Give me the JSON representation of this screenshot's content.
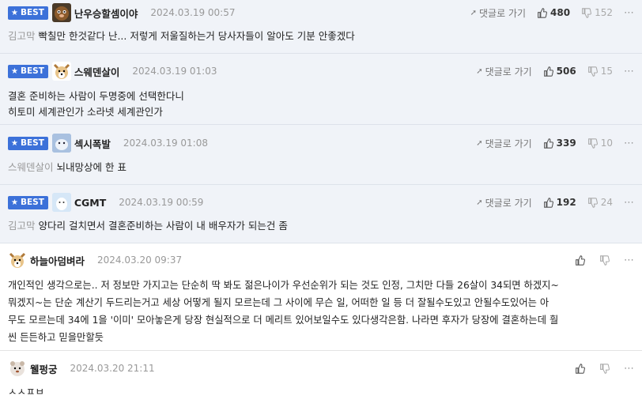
{
  "reply_label": "댓글로 가기",
  "comments": [
    {
      "best": true,
      "badge": "BEST",
      "nick": "난우승할셈이야",
      "date": "2024.03.19 00:57",
      "likes": "480",
      "dislikes": "152",
      "mention": "김고막",
      "text": "빡칠만 한것같다 난... 저렇게 저울질하는거 당사자들이 알아도 기분 안좋겠다"
    },
    {
      "best": true,
      "badge": "BEST",
      "nick": "스웨덴살이",
      "date": "2024.03.19 01:03",
      "likes": "506",
      "dislikes": "15",
      "lines": [
        "결혼 준비하는 사람이 두명중에 선택한다니",
        "히토미 세계관인가 소라넷 세계관인가"
      ]
    },
    {
      "best": true,
      "badge": "BEST",
      "nick": "섹시폭발",
      "date": "2024.03.19 01:08",
      "likes": "339",
      "dislikes": "10",
      "mention": "스웨덴살이",
      "text": "뇌내망상에 한 표"
    },
    {
      "best": true,
      "badge": "BEST",
      "nick": "CGMT",
      "date": "2024.03.19 00:59",
      "likes": "192",
      "dislikes": "24",
      "mention": "김고막",
      "text": "양다리 걸치면서 결혼준비하는 사람이 내 배우자가 되는건 좀"
    },
    {
      "best": false,
      "nick": "하늘아덤벼라",
      "date": "2024.03.20 09:37",
      "lines": [
        "개인적인 생각으로는.. 저 정보만 가지고는 단순히 딱 봐도 젊은나이가 우선순위가 되는 것도 인정, 그치만 다들 26살이 34되면 하겠지~",
        "뭐겠지~는 단순 계산기 두드리는거고 세상 어떻게 될지 모르는데 그 사이에 무슨 일, 어떠한 일 등 더 잘될수도있고 안될수도있어는 아",
        "무도 모르는데 34에 1을 '이미' 모아놓은게 당장 현실적으로 더 메리트 있어보일수도 있다생각은함. 나라면 후자가 당장에 결혼하는데 훨",
        "씬 든든하고 믿을만할듯"
      ]
    },
    {
      "best": false,
      "nick": "웰펑궁",
      "date": "2024.03.20 21:11",
      "lines": [
        "ㅅㅅㅍㅂ"
      ]
    }
  ]
}
